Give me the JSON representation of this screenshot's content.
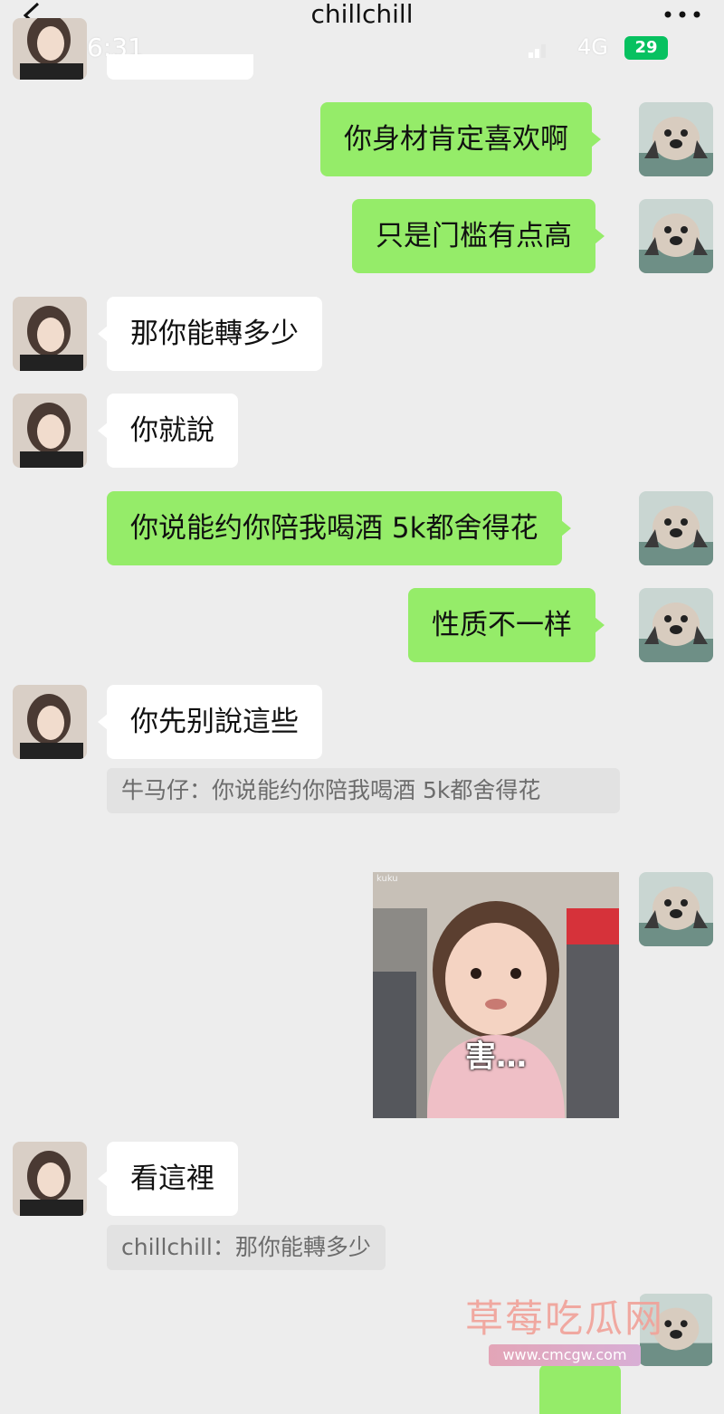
{
  "header": {
    "title": "chillchill",
    "back_icon": "chevron-left-icon",
    "more_icon": "more-dots-icon"
  },
  "status_bar": {
    "time": "6:31",
    "network": "4G",
    "battery": "29"
  },
  "colors": {
    "sent_bubble": "#95ec69",
    "received_bubble": "#ffffff",
    "background": "#ededed",
    "quote_background": "#e2e2e2"
  },
  "messages": [
    {
      "side": "right",
      "text": "你身材肯定喜欢啊"
    },
    {
      "side": "right",
      "text": "只是门槛有点高"
    },
    {
      "side": "left",
      "text": "那你能轉多少"
    },
    {
      "side": "left",
      "text": "你就說"
    },
    {
      "side": "right",
      "text": "你说能约你陪我喝酒  5k都舍得花"
    },
    {
      "side": "right",
      "text": "性质不一样"
    },
    {
      "side": "left",
      "text": "你先别說這些",
      "quote": "牛马仔：你说能约你陪我喝酒  5k都舍得花"
    },
    {
      "side": "right",
      "type": "image",
      "image_label": "kuku",
      "caption": "害…"
    },
    {
      "side": "left",
      "text": "看這裡",
      "quote": "chillchill：那你能轉多少"
    }
  ],
  "watermark": {
    "text": "草莓吃瓜网",
    "url": "www.cmcgw.com"
  }
}
